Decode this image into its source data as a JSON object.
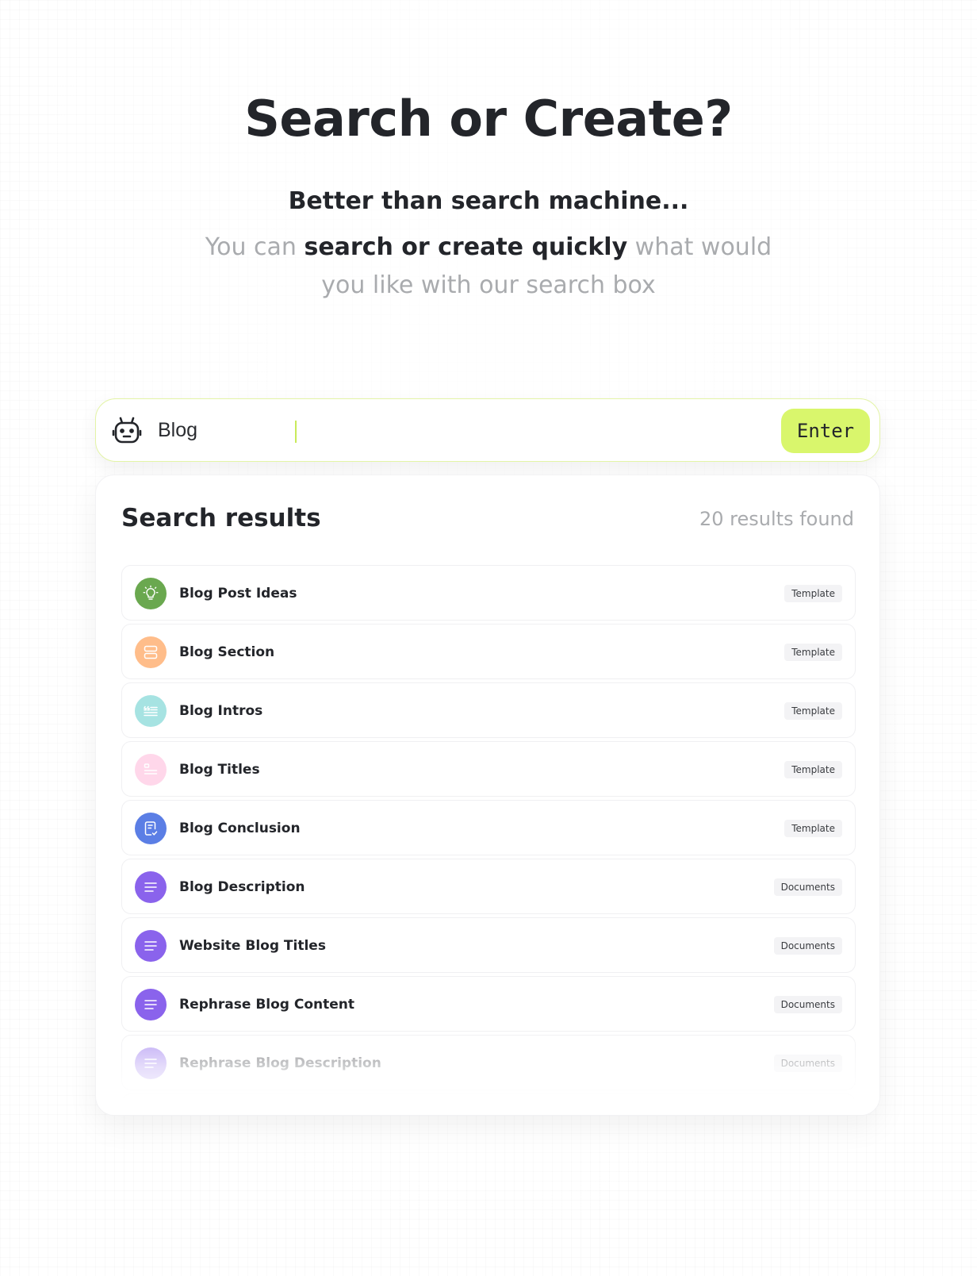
{
  "hero": {
    "title": "Search or Create?",
    "tagline": "Better than search machine...",
    "description_prefix": "You can ",
    "description_bold": "search or create quickly",
    "description_suffix": " what would you like with our search box"
  },
  "search": {
    "value": "Blog",
    "enter_label": "Enter",
    "bot_icon": "robot-icon",
    "accent_color": "#d9f66c"
  },
  "results": {
    "title": "Search results",
    "count_text": "20 results found",
    "items": [
      {
        "label": "Blog Post Ideas",
        "badge": "Template",
        "icon": "lightbulb-icon",
        "color": "#6aa84f"
      },
      {
        "label": "Blog Section",
        "badge": "Template",
        "icon": "sections-icon",
        "color": "#ffbd8a"
      },
      {
        "label": "Blog Intros",
        "badge": "Template",
        "icon": "quote-lines-icon",
        "color": "#a6e3e2"
      },
      {
        "label": "Blog Titles",
        "badge": "Template",
        "icon": "title-lines-icon",
        "color": "#ffd7ea"
      },
      {
        "label": "Blog Conclusion",
        "badge": "Template",
        "icon": "document-check-icon",
        "color": "#5b7ee5"
      },
      {
        "label": "Blog Description",
        "badge": "Documents",
        "icon": "text-lines-icon",
        "color": "#8a63ec"
      },
      {
        "label": "Website Blog Titles",
        "badge": "Documents",
        "icon": "text-lines-icon",
        "color": "#8a63ec"
      },
      {
        "label": "Rephrase Blog Content",
        "badge": "Documents",
        "icon": "text-lines-icon",
        "color": "#8a63ec"
      },
      {
        "label": "Rephrase Blog Description",
        "badge": "Documents",
        "icon": "text-lines-icon",
        "color": "#b49bf3"
      }
    ]
  }
}
